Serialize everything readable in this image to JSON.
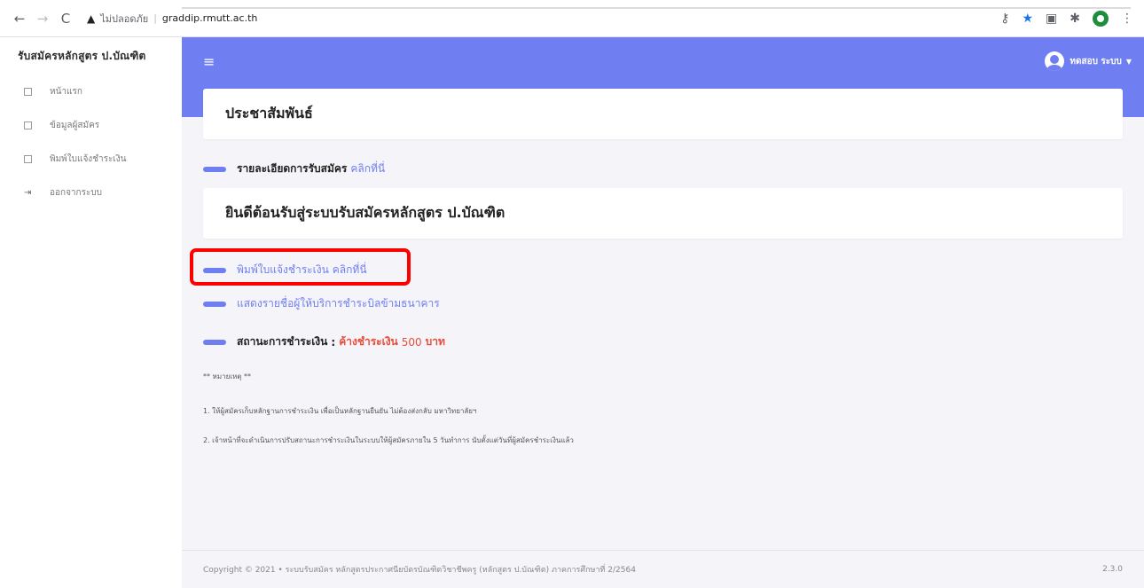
{
  "browser": {
    "insecure_label": "ไม่ปลอดภัย",
    "separator": "|",
    "url": "graddip.rmutt.ac.th"
  },
  "sidebar": {
    "brand": "รับสมัครหลักสูตร ป.บัณฑิต",
    "items": [
      {
        "label": "หน้าแรก"
      },
      {
        "label": "ข้อมูลผู้สมัคร"
      },
      {
        "label": "พิมพ์ใบแจ้งชำระเงิน"
      },
      {
        "label": "ออกจากระบบ"
      }
    ]
  },
  "topbar": {
    "user_name": "ทดสอบ ระบบ"
  },
  "main": {
    "announcement_title": "ประชาสัมพันธ์",
    "admission_details_label": "รายละเอียดการรับสมัคร",
    "admission_details_link": "คลิกที่นี่",
    "welcome_title": "ยินดีต้อนรับสู่ระบบรับสมัครหลักสูตร ป.บัณฑิต",
    "print_invoice_label": "พิมพ์ใบแจ้งชำระเงิน",
    "print_invoice_link": "คลิกที่นี่",
    "bill_providers_link": "แสดงรายชื่อผู้ให้บริการชำระบิลข้ามธนาคาร",
    "payment_status_label": "สถานะการชำระเงิน",
    "payment_status_colon": ":",
    "payment_status_value": "ค้างชำระเงิน",
    "payment_amount": "500",
    "payment_unit": "บาท"
  },
  "notes": {
    "header": "** หมายเหตุ **",
    "items": [
      "1. ให้ผู้สมัครเก็บหลักฐานการชำระเงิน เพื่อเป็นหลักฐานยืนยัน ไม่ต้องส่งกลับ มหาวิทยาลัยฯ",
      "2. เจ้าหน้าที่จะดำเนินการปรับสถานะการชำระเงินในระบบให้ผู้สมัครภายใน 5 วันทำการ นับตั้งแต่วันที่ผู้สมัครชำระเงินแล้ว"
    ]
  },
  "footer": {
    "copyright": "Copyright © 2021 • ระบบรับสมัคร หลักสูตรประกาศนียบัตรบัณฑิตวิชาชีพครู (หลักสูตร ป.บัณฑิต) ภาคการศึกษาที่ 2/2564",
    "version": "2.3.0"
  },
  "colors": {
    "accent": "#6f7ef0",
    "danger": "#e74c3c",
    "highlight": "#ff0000"
  }
}
